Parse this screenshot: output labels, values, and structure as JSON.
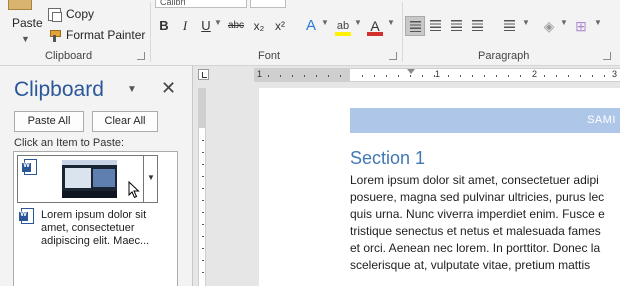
{
  "ribbon": {
    "clipboard_group": {
      "paste_label": "Paste",
      "copy_label": "Copy",
      "format_painter_label": "Format Painter",
      "group_label": "Clipboard"
    },
    "font_group": {
      "font_name": "Calibri",
      "bold": "B",
      "italic": "I",
      "underline": "U",
      "strikethrough": "abc",
      "subscript": "x₂",
      "superscript": "x²",
      "group_label": "Font",
      "font_color": "#d32f2f",
      "highlight_color": "#fff200"
    },
    "paragraph_group": {
      "group_label": "Paragraph"
    }
  },
  "clipboard_pane": {
    "title": "Clipboard",
    "paste_all": "Paste All",
    "clear_all": "Clear All",
    "hint": "Click an Item to Paste:",
    "items": [
      {
        "type": "image",
        "icon": "word-doc-icon"
      },
      {
        "type": "text",
        "icon": "word-doc-icon",
        "lines": [
          "Lorem ipsum dolor sit",
          "amet, consectetuer",
          "adipiscing elit. Maec..."
        ]
      }
    ]
  },
  "ruler": {
    "numbers": [
      "1",
      "1",
      "2",
      "3"
    ]
  },
  "document": {
    "banner_text": "SAMI",
    "section_title": "Section 1",
    "body_lines": [
      "Lorem ipsum dolor sit amet, consectetuer adipi",
      "posuere, magna sed pulvinar ultricies, purus lec",
      "quis urna. Nunc viverra imperdiet enim. Fusce e",
      "tristique senectus et netus et malesuada fames",
      "et orci. Aenean nec lorem. In porttitor. Donec la",
      "scelerisque at, vulputate vitae, pretium mattis"
    ]
  },
  "colors": {
    "accent_blue": "#2b579a",
    "heading_blue": "#4178b4",
    "banner_blue": "#aec7e8"
  }
}
